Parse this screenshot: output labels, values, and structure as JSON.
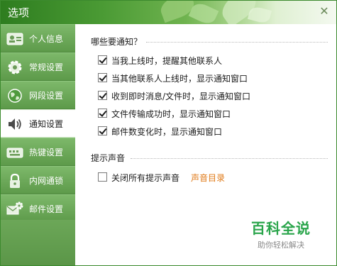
{
  "window": {
    "title": "选项"
  },
  "sidebar": {
    "items": [
      {
        "label": "个人信息",
        "icon": "id-card-icon"
      },
      {
        "label": "常规设置",
        "icon": "gear-icon"
      },
      {
        "label": "网段设置",
        "icon": "globe-icon"
      },
      {
        "label": "通知设置",
        "icon": "speaker-icon",
        "active": true
      },
      {
        "label": "热键设置",
        "icon": "keyboard-icon"
      },
      {
        "label": "内网通锁",
        "icon": "lock-icon"
      },
      {
        "label": "邮件设置",
        "icon": "mail-gear-icon"
      }
    ]
  },
  "notify": {
    "title": "哪些要通知？",
    "options": [
      {
        "label": "当我上线时，提醒其他联系人",
        "checked": true
      },
      {
        "label": "当其他联系人上线时，显示通知窗口",
        "checked": true
      },
      {
        "label": "收到即时消息/文件时，显示通知窗口",
        "checked": true
      },
      {
        "label": "文件传输成功时，显示通知窗口",
        "checked": true
      },
      {
        "label": "邮件数变化时，显示通知窗口",
        "checked": true
      }
    ]
  },
  "sound": {
    "title": "提示声音",
    "mute_label": "关闭所有提示声音",
    "mute_checked": false,
    "directory_link": "声音目录"
  },
  "watermark": {
    "main": "百科全说",
    "sub": "助你轻松解决"
  },
  "colors": {
    "sidebar": "#6da85a",
    "active_bg": "#ffffff",
    "link": "#e07b1a",
    "watermark": "#2aa54b"
  }
}
